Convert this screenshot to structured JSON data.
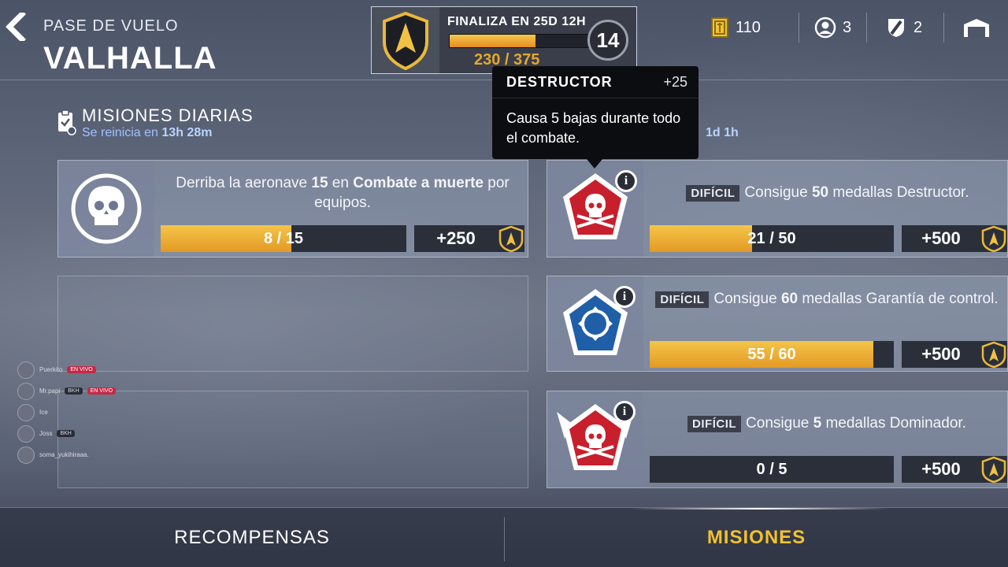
{
  "header": {
    "breadcrumb": "PASE DE VUELO",
    "title": "VALHALLA"
  },
  "pass": {
    "ends_label": "FINALIZA EN 25D 12H",
    "progress_text": "230 / 375",
    "progress_fraction": 0.613,
    "level": "14"
  },
  "currencies": [
    {
      "icon": "gold-ticket-icon",
      "value": "110"
    },
    {
      "icon": "user-circle-icon",
      "value": "3"
    },
    {
      "icon": "shield-badge-icon",
      "value": "2"
    },
    {
      "icon": "hangar-icon",
      "value": ""
    }
  ],
  "daily": {
    "title": "MISIONES DIARIAS",
    "reset_prefix": "Se reinicia en",
    "reset_time": "13h 28m"
  },
  "weekly": {
    "reset_time": "1d 1h"
  },
  "daily_missions": [
    {
      "text_parts": [
        "Derriba la aeronave ",
        "15",
        " en ",
        "Combate a muerte",
        " por equipos."
      ],
      "progress_text": "8 / 15",
      "progress_fraction": 0.533,
      "reward": "+250"
    }
  ],
  "weekly_missions": [
    {
      "difficulty": "DIFÍCIL",
      "text_parts": [
        "Consigue ",
        "50",
        " medallas Destructor."
      ],
      "progress_text": "21 / 50",
      "progress_fraction": 0.42,
      "reward": "+500",
      "badge_color": "#c81f2c",
      "badge_icon": "skull-crossbones-icon"
    },
    {
      "difficulty": "DIFÍCIL",
      "text_parts": [
        "Consigue ",
        "60",
        " medallas Garantía de control."
      ],
      "progress_text": "55 / 60",
      "progress_fraction": 0.917,
      "reward": "+500",
      "badge_color": "#1f5fa8",
      "badge_icon": "target-circle-icon"
    },
    {
      "difficulty": "DIFÍCIL",
      "text_parts": [
        "Consigue ",
        "5",
        " medallas Dominador."
      ],
      "progress_text": "0 / 5",
      "progress_fraction": 0,
      "reward": "+500",
      "badge_color": "#c81f2c",
      "badge_icon": "skull-crossbones-winged-icon"
    }
  ],
  "tooltip": {
    "title": "DESTRUCTOR",
    "amount": "+25",
    "body": "Causa 5 bajas durante todo el combate."
  },
  "live_viewers": [
    {
      "name": "Puerkito",
      "tag": "EN VIVO",
      "badge": ""
    },
    {
      "name": "Mr.papi",
      "tag": "EN VIVO",
      "badge": "BKH"
    },
    {
      "name": "Ice",
      "tag": "",
      "badge": ""
    },
    {
      "name": "Joss",
      "tag": "",
      "badge": "BKH"
    },
    {
      "name": "soma_yukihiraaa.",
      "tag": "",
      "badge": ""
    }
  ],
  "tabs": {
    "rewards": "RECOMPENSAS",
    "missions": "MISIONES"
  }
}
